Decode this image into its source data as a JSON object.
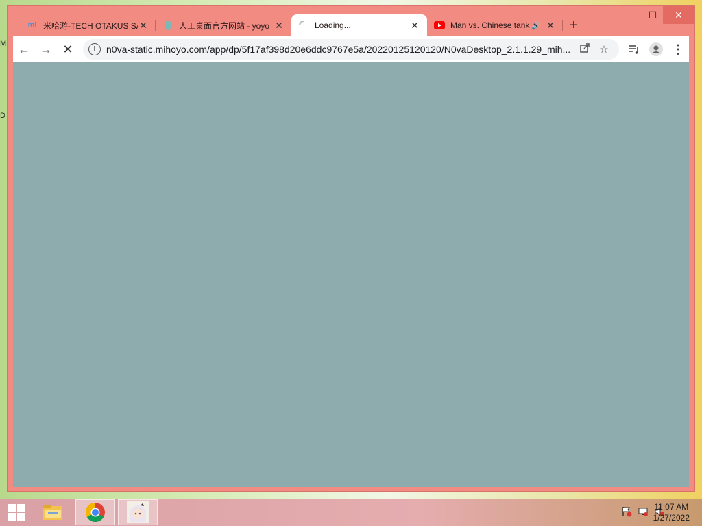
{
  "desktop": {
    "edge_letters": [
      "M",
      "D"
    ]
  },
  "browser": {
    "tabs": [
      {
        "favicon": "mi",
        "title": "米哈游-TECH OTAKUS SA",
        "close": "✕"
      },
      {
        "favicon": "yoyo",
        "title": "人工桌面官方网站 - yoyo",
        "close": "✕"
      },
      {
        "favicon": "loading",
        "title": "Loading...",
        "close": "✕",
        "active": true
      },
      {
        "favicon": "youtube",
        "title": "Man vs. Chinese tank",
        "close": "✕",
        "audio": true
      }
    ],
    "new_tab": "+",
    "window_controls": {
      "minimize": "–",
      "maximize": "☐",
      "close": "✕"
    },
    "toolbar": {
      "back": "←",
      "forward": "→",
      "stop": "✕",
      "url": "n0va-static.mihoyo.com/app/dp/5f17af398d20e6ddc9767e5a/20220125120120/N0vaDesktop_2.1.1.29_mih...",
      "info": "i"
    },
    "content_color": "#8eacad",
    "frame_color": "#f28b82"
  },
  "taskbar": {
    "clock_time": "11:07 AM",
    "clock_date": "1/27/2022"
  }
}
